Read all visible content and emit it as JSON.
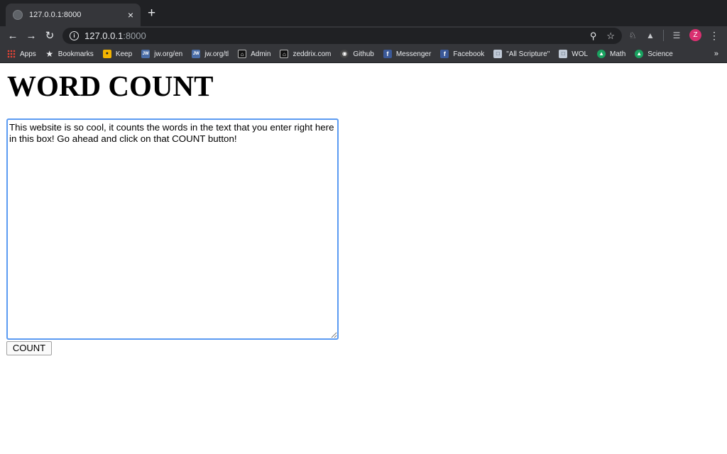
{
  "browser": {
    "tab_title": "127.0.0.1:8000",
    "tab_close": "×",
    "new_tab": "+",
    "address_host": "127.0.0.1",
    "address_port": ":8000",
    "avatar_letter": "Z",
    "bookmarks_more": "»",
    "bookmarks": [
      {
        "label": "Apps",
        "icon": "apps-icon"
      },
      {
        "label": "Bookmarks",
        "icon": "star-icon"
      },
      {
        "label": "Keep",
        "icon": "keep-icon"
      },
      {
        "label": "jw.org/en",
        "icon": "jw-icon"
      },
      {
        "label": "jw.org/tl",
        "icon": "jw-icon"
      },
      {
        "label": "Admin",
        "icon": "house-icon"
      },
      {
        "label": "zeddrix.com",
        "icon": "house-icon"
      },
      {
        "label": "Github",
        "icon": "github-icon"
      },
      {
        "label": "Messenger",
        "icon": "facebook-icon"
      },
      {
        "label": "Facebook",
        "icon": "facebook-icon"
      },
      {
        "label": "\"All Scripture\"",
        "icon": "book-icon"
      },
      {
        "label": "WOL",
        "icon": "book-icon"
      },
      {
        "label": "Math",
        "icon": "khan-icon"
      },
      {
        "label": "Science",
        "icon": "khan-icon"
      }
    ]
  },
  "page": {
    "heading": "WORD COUNT",
    "textarea_value": "This website is so cool, it counts the words in the text that you enter right here in this box! Go ahead and click on that COUNT button!",
    "count_button": "COUNT"
  },
  "colors": {
    "chrome_dark": "#202124",
    "chrome_toolbar": "#35363a",
    "focus_ring": "#5b9bf2",
    "avatar": "#d93070"
  }
}
